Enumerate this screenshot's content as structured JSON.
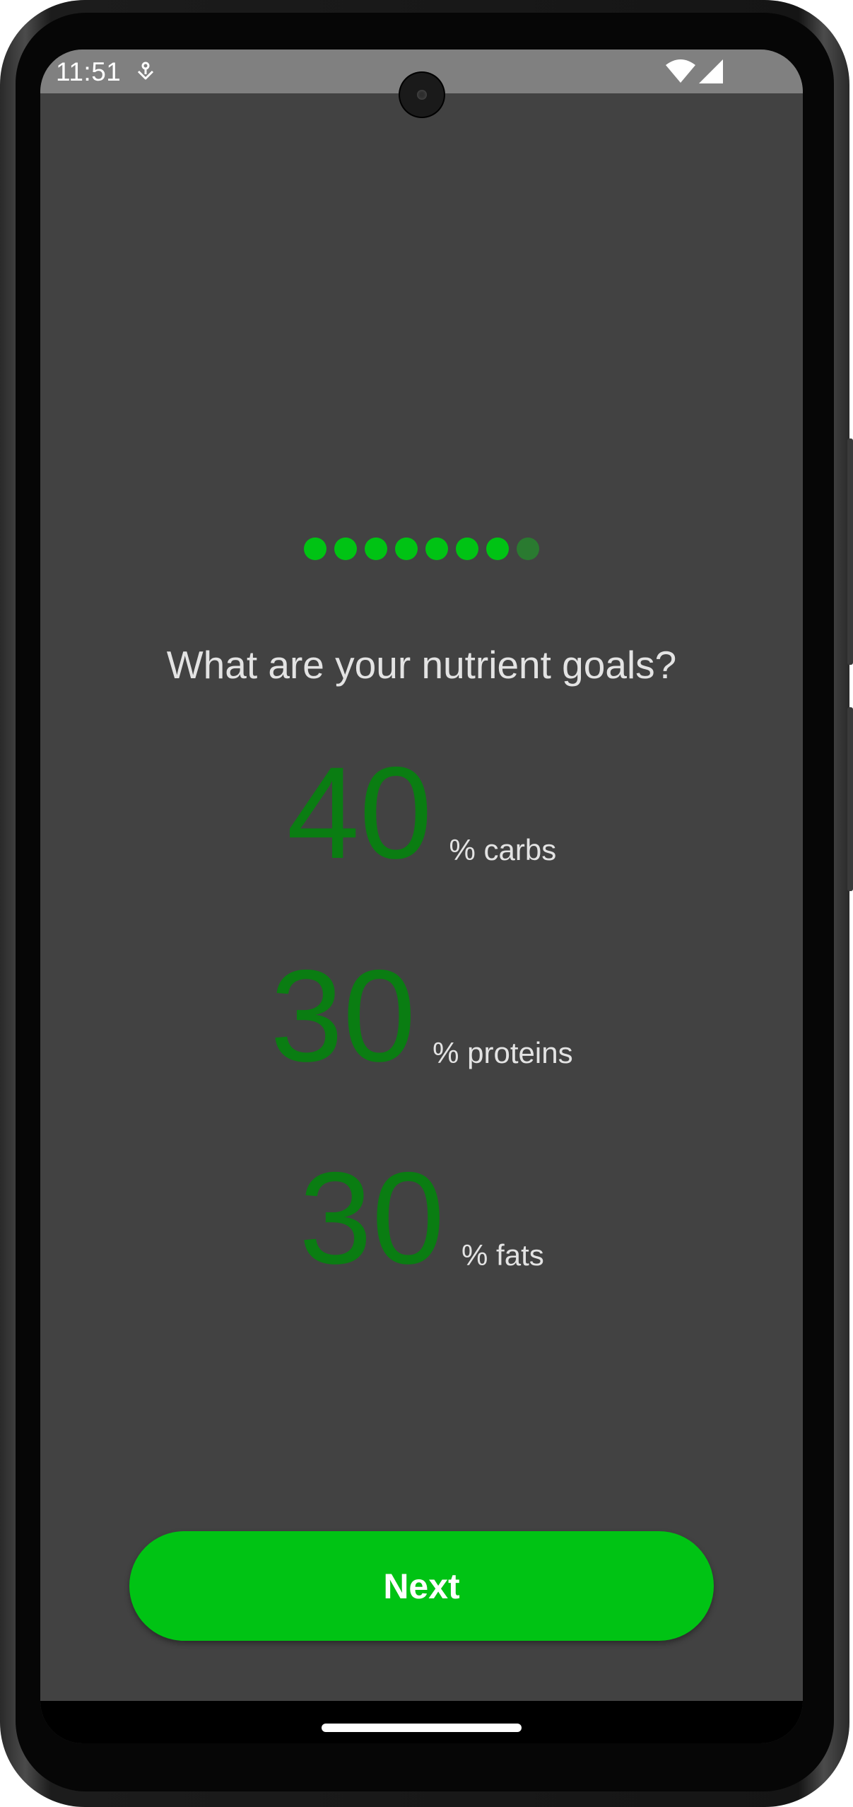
{
  "status_bar": {
    "time": "11:51",
    "icons": [
      "notification-icon",
      "wifi-icon",
      "cell-signal-icon"
    ]
  },
  "onboarding": {
    "progress": {
      "total_steps": 8,
      "current_step": 7
    },
    "question": "What are your nutrient goals?",
    "goals": [
      {
        "value": "40",
        "unit": "% carbs"
      },
      {
        "value": "30",
        "unit": "% proteins"
      },
      {
        "value": "30",
        "unit": "% fats"
      }
    ],
    "next_label": "Next"
  },
  "colors": {
    "background": "#424242",
    "accent": "#00c314",
    "goal_value": "#0a7d12",
    "inactive_dot": "#2a7a30",
    "text": "#e3e3e3",
    "status_bar": "#808080"
  }
}
